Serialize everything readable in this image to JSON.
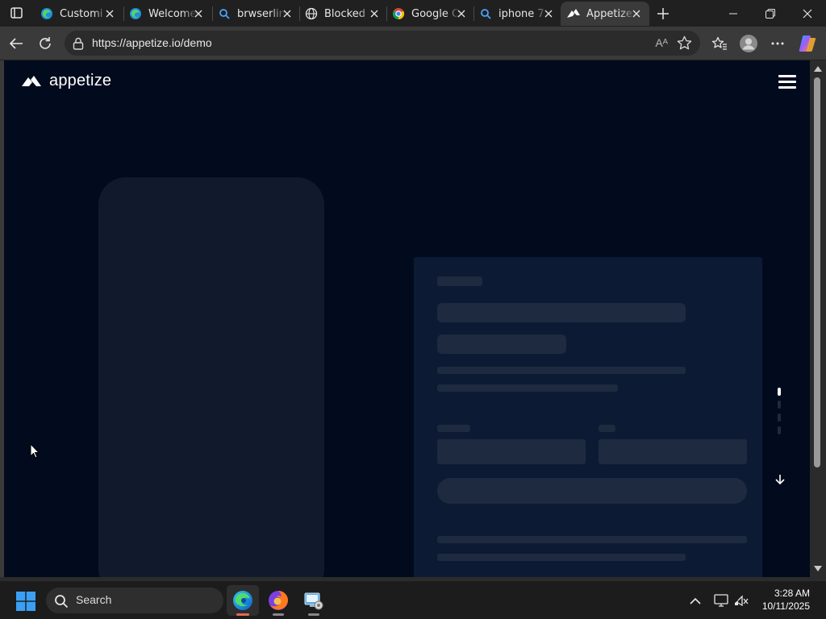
{
  "browser": {
    "tabs": [
      {
        "title": "Customi",
        "icon": "edge-icon",
        "active": false
      },
      {
        "title": "Welcome",
        "icon": "edge-icon",
        "active": false
      },
      {
        "title": "brwserlin",
        "icon": "search-icon",
        "active": false
      },
      {
        "title": "Blocked",
        "icon": "globe-icon",
        "active": false
      },
      {
        "title": "Google C",
        "icon": "chrome-icon",
        "active": false
      },
      {
        "title": "iphone 7",
        "icon": "search-icon",
        "active": false
      },
      {
        "title": "Appetize",
        "icon": "appetize-icon",
        "active": true
      }
    ],
    "url": "https://appetize.io/demo",
    "read_aloud_glyph": "Aᴬ",
    "accent": "#3a3a3a"
  },
  "page": {
    "brand_name": "appetize",
    "background": "#020b1d",
    "skeleton_color": "#1e2a40"
  },
  "taskbar": {
    "search_placeholder": "Search",
    "time": "3:28 AM",
    "date": "10/11/2025",
    "apps": [
      {
        "name": "Microsoft Edge",
        "icon": "edge-icon",
        "active": true
      },
      {
        "name": "Firefox",
        "icon": "firefox-icon",
        "active": false
      },
      {
        "name": "Control Panel",
        "icon": "control-panel-icon",
        "active": false
      }
    ]
  }
}
